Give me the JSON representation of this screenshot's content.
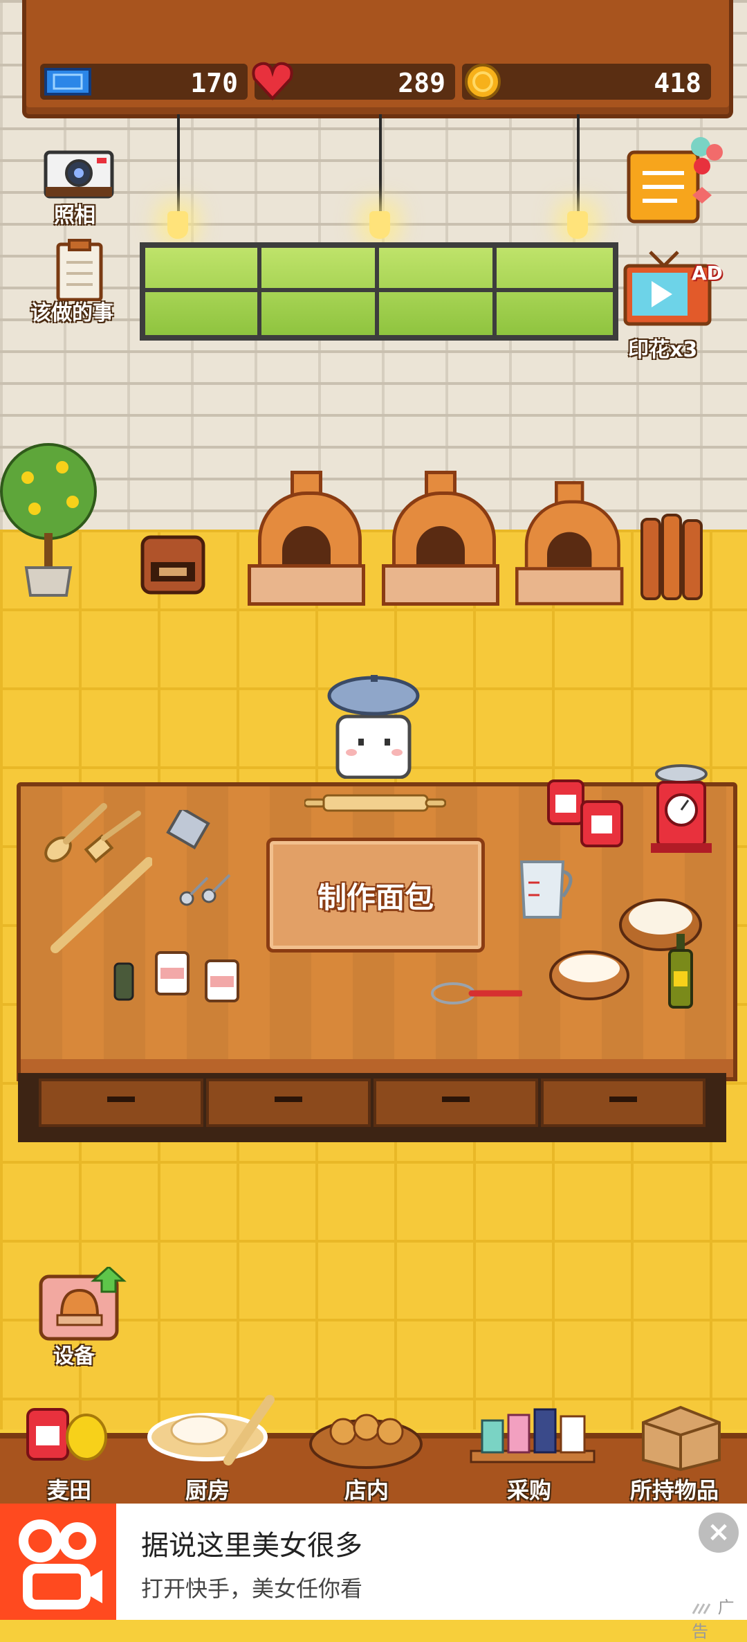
{
  "hud": {
    "tickets": "170",
    "hearts": "289",
    "coins": "418"
  },
  "side_buttons": {
    "camera_label": "照相",
    "todo_label": "该做的事",
    "ad_tv_label": "印花x3",
    "ad_badge": "AD",
    "equipment_label": "设备"
  },
  "table": {
    "make_bread_label": "制作面包"
  },
  "bottom_nav": {
    "items": [
      {
        "label": "麦田"
      },
      {
        "label": "厨房"
      },
      {
        "label": "店内"
      },
      {
        "label": "采购"
      },
      {
        "label": "所持物品"
      }
    ]
  },
  "ad_banner": {
    "title": "据说这里美女很多",
    "subtitle": "打开快手，美女任你看",
    "tag": "广告",
    "close_glyph": "×"
  },
  "colors": {
    "floor": "#f6c93a",
    "wall": "#ebe4d6",
    "board": "#a8541e",
    "ad_brand": "#ff4a1f"
  }
}
